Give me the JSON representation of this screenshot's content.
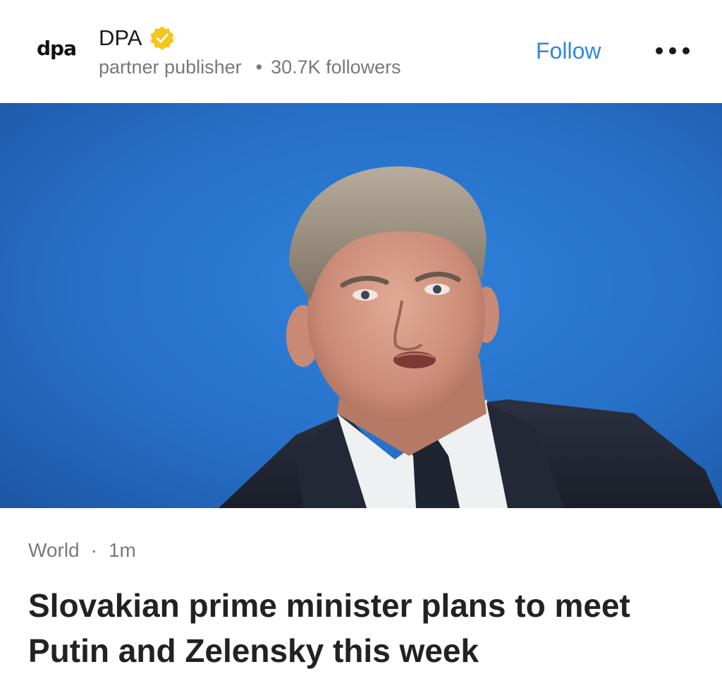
{
  "publisher": {
    "logo_text": "dpa",
    "name": "DPA",
    "verified_icon": "verified-badge-icon",
    "type": "partner publisher",
    "separator": "•",
    "followers": "30.7K followers"
  },
  "actions": {
    "follow_label": "Follow",
    "more_icon": "more-options-icon"
  },
  "article": {
    "category": "World",
    "separator": "·",
    "time": "1m",
    "headline": "Slovakian prime minister plans to meet Putin and Zelensky this week"
  },
  "colors": {
    "accent": "#2f86e6",
    "verified": "#f5c518",
    "hero_background": "#2a6fc9"
  }
}
